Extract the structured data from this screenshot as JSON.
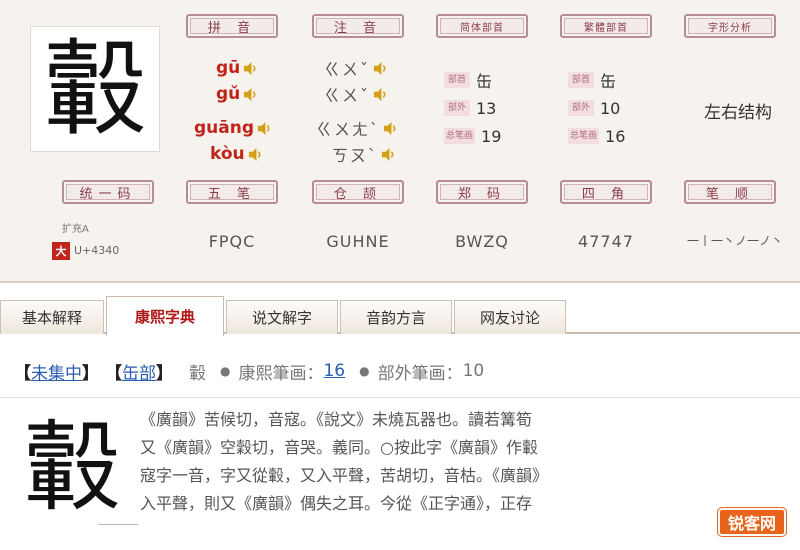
{
  "character": "轂",
  "labels": {
    "pinyin": "拼 音",
    "zhuyin": "注 音",
    "simplified": "简体部首",
    "traditional": "繁體部首",
    "structure_analysis": "字形分析",
    "unicode": "统一码",
    "wubi": "五 笔",
    "cangjie": "仓 颉",
    "zhengma": "郑 码",
    "sijiao": "四 角",
    "strokes_order": "笔 顺"
  },
  "pinyin": [
    "gū",
    "gǔ",
    "guāng",
    "kòu"
  ],
  "zhuyin": [
    "ㄍㄨˇ",
    "ㄍㄨˇ",
    "ㄍㄨㄤˋ",
    "ㄎㄡˋ"
  ],
  "simplified": {
    "radical_tag": "部首",
    "radical": "缶",
    "outer_tag": "部外",
    "outer": "13",
    "total_tag": "总笔画",
    "total": "19"
  },
  "traditional": {
    "radical_tag": "部首",
    "radical": "缶",
    "outer_tag": "部外",
    "outer": "10",
    "total_tag": "总笔画",
    "total": "16"
  },
  "structure": "左右结构",
  "unicode": {
    "ext": "扩充A",
    "badge": "大",
    "code": "U+4340"
  },
  "wubi": "FPQC",
  "cangjie": "GUHNE",
  "zhengma": "BWZQ",
  "sijiao": "47747",
  "stroke_order": "一丨一丶ノ一ノ丶",
  "tabs": [
    "基本解释",
    "康熙字典",
    "说文解字",
    "音韵方言",
    "网友讨论"
  ],
  "dict": {
    "open": "【",
    "close": "】",
    "collection": "未集中",
    "radical": "缶部",
    "char": "轂",
    "kx_label": "康熙筆画：",
    "kx_strokes": "16",
    "outer_label": "部外筆画：",
    "outer_strokes": "10",
    "lines": [
      "《廣韻》苦候切，音寇。《說文》未燒瓦器也。讀若篝筍",
      "又《廣韻》空穀切，音哭。義同。○按此字《廣韻》作轂",
      "寇字一音，字又從轂，又入平聲，苦胡切，音枯。《廣韻》",
      "入平聲，則又《廣韻》偶失之耳。今從《正字通》，正存"
    ]
  },
  "watermark": "锐客网"
}
